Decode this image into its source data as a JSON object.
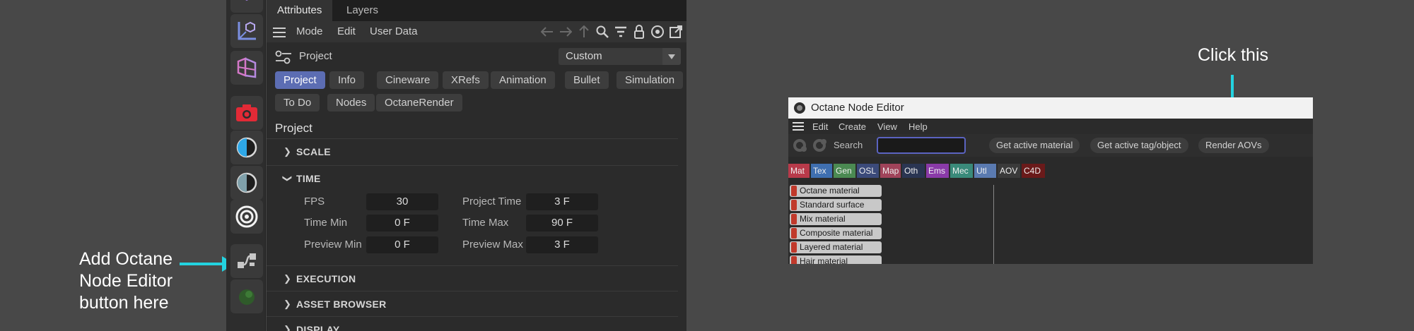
{
  "annotations": {
    "left_text": "Add Octane Node Editor button here",
    "right_text": "Click this",
    "arrow_color": "#23d3e0"
  },
  "toolbar": {
    "buttons": [
      {
        "name": "cube-icon"
      },
      {
        "name": "axis-icon"
      },
      {
        "name": "fold-icon"
      },
      {
        "name": "camera-icon"
      },
      {
        "name": "contrast-icon"
      },
      {
        "name": "contrast-dark-icon"
      },
      {
        "name": "target-icon"
      },
      {
        "name": "node-editor-icon"
      },
      {
        "name": "green-blob-icon"
      }
    ]
  },
  "attributes": {
    "tabs": [
      "Attributes",
      "Layers"
    ],
    "menu": [
      "Mode",
      "Edit",
      "User Data"
    ],
    "object_label": "Project",
    "preset": "Custom",
    "pill_row1": [
      "Project",
      "Info",
      "Cineware",
      "XRefs",
      "Animation",
      "Bullet",
      "Simulation"
    ],
    "pill_row2": [
      "To Do",
      "Nodes",
      "OctaneRender"
    ],
    "section_title": "Project",
    "groups": {
      "scale": "SCALE",
      "time": "TIME",
      "execution": "EXECUTION",
      "asset_browser": "ASSET BROWSER",
      "display": "DISPLAY"
    },
    "fields": {
      "fps_label": "FPS",
      "fps": "30",
      "project_time_label": "Project Time",
      "project_time": "3 F",
      "time_min_label": "Time Min",
      "time_min": "0 F",
      "time_max_label": "Time Max",
      "time_max": "90 F",
      "preview_min_label": "Preview Min",
      "preview_min": "0 F",
      "preview_max_label": "Preview Max",
      "preview_max": "3 F"
    }
  },
  "node_editor": {
    "title": "Octane Node Editor",
    "menu": [
      "Edit",
      "Create",
      "View",
      "Help"
    ],
    "search_label": "Search",
    "search_value": "",
    "buttons": [
      "Get active material",
      "Get active tag/object",
      "Render AOVs"
    ],
    "categories": [
      {
        "label": "Mat",
        "color": "#b83a4a"
      },
      {
        "label": "Tex",
        "color": "#3f6fb0"
      },
      {
        "label": "Gen",
        "color": "#4b8a52"
      },
      {
        "label": "OSL",
        "color": "#3b4a7a"
      },
      {
        "label": "Map",
        "color": "#a0435a"
      },
      {
        "label": "Oth",
        "color": "#2a3552"
      },
      {
        "label": "Ems",
        "color": "#8a3aa8"
      },
      {
        "label": "Mec",
        "color": "#3a8a7a"
      },
      {
        "label": "Utl",
        "color": "#5a7ab0"
      },
      {
        "label": "AOV",
        "color": "#3a3a3a"
      },
      {
        "label": "C4D",
        "color": "#6a1a1a"
      }
    ],
    "nodes": [
      "Octane material",
      "Standard surface",
      "Mix material",
      "Composite material",
      "Layered material",
      "Hair material"
    ]
  }
}
